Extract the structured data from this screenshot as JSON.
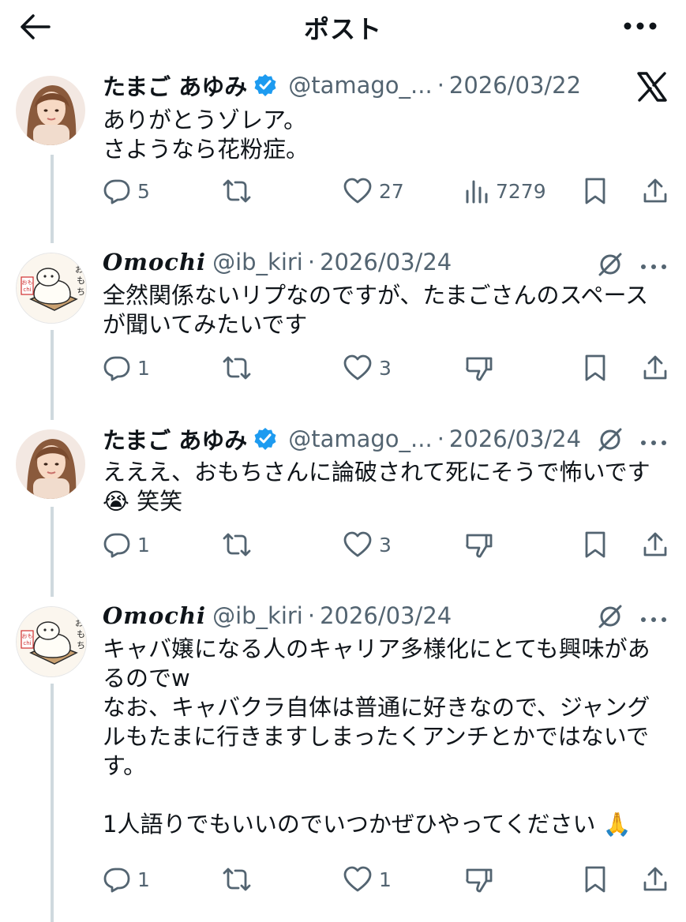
{
  "header": {
    "title": "ポスト"
  },
  "posts": [
    {
      "name": "たまご あゆみ",
      "handle": "@tamago_...",
      "dot": "·",
      "date": "2026/03/22",
      "body": "ありがとうゾレア。\nさようなら花粉症。",
      "replies": "5",
      "likes": "27",
      "views": "7279"
    },
    {
      "name": "Omochi",
      "handle": "@ib_kiri",
      "dot": "·",
      "date": "2026/03/24",
      "body": "全然関係ないリプなのですが、たまごさんのスペース\nが聞いてみたいです",
      "replies": "1",
      "likes": "3"
    },
    {
      "name": "たまご あゆみ",
      "handle": "@tamago_...",
      "dot": "·",
      "date": "2026/03/24",
      "body": "えええ、おもちさんに論破されて死にそうで怖いです\n😭 笑笑",
      "replies": "1",
      "likes": "3"
    },
    {
      "name": "Omochi",
      "handle": "@ib_kiri",
      "dot": "·",
      "date": "2026/03/24",
      "body": "キャバ嬢になる人のキャリア多様化にとても興味があ\nるのでw\nなお、キャバクラ自体は普通に好きなので、ジャング\nルもたまに行きますしまったくアンチとかではないで\nす。\n\n1人語りでもいいのでいつかぜひやってください 🙏",
      "replies": "1",
      "likes": "1"
    }
  ],
  "avatar_text": {
    "omochi_kanji": "おもち",
    "omochi_badge": "おもchi"
  },
  "colors": {
    "text": "#0f1419",
    "secondary": "#536471",
    "verified": "#1d9bf0",
    "thread": "#cfd9de"
  }
}
